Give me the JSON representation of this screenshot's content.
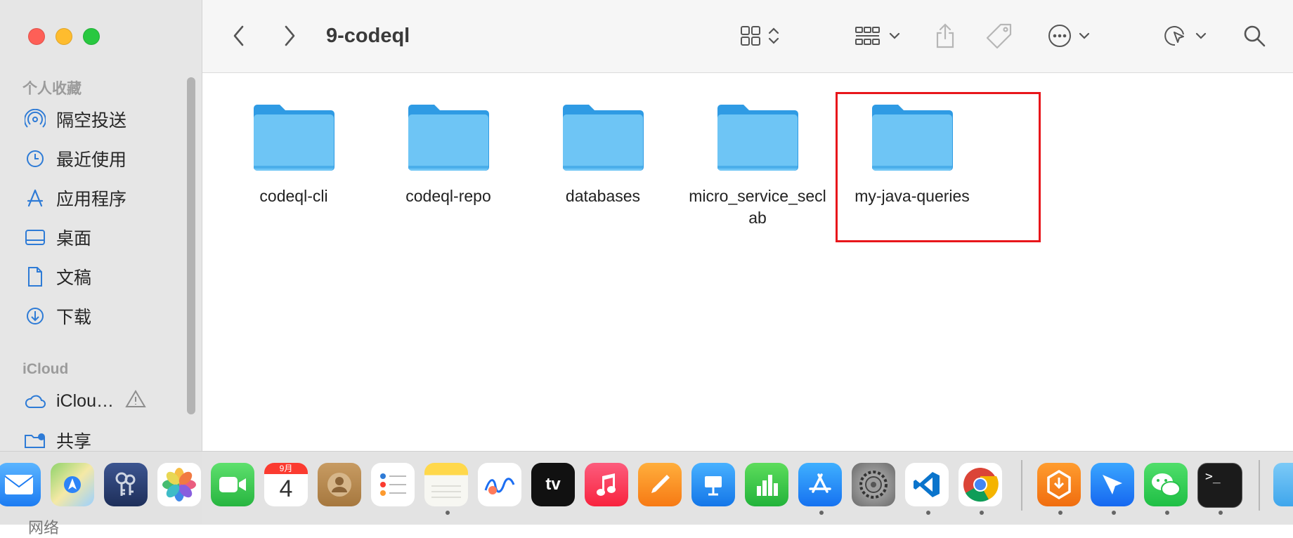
{
  "window": {
    "title": "9-codeql"
  },
  "sidebar": {
    "favorites_title": "个人收藏",
    "items": [
      {
        "label": "隔空投送",
        "icon": "airdrop-icon"
      },
      {
        "label": "最近使用",
        "icon": "clock-icon"
      },
      {
        "label": "应用程序",
        "icon": "applications-icon"
      },
      {
        "label": "桌面",
        "icon": "desktop-icon"
      },
      {
        "label": "文稿",
        "icon": "document-icon"
      },
      {
        "label": "下载",
        "icon": "download-icon"
      }
    ],
    "icloud_title": "iCloud",
    "icloud_items": [
      {
        "label": "iClou…",
        "icon": "icloud-icon"
      },
      {
        "label": "共享",
        "icon": "shared-folder-icon"
      }
    ],
    "network_label": "网络"
  },
  "folders": [
    {
      "name": "codeql-cli"
    },
    {
      "name": "codeql-repo"
    },
    {
      "name": "databases"
    },
    {
      "name": "micro_service_seclab"
    },
    {
      "name": "my-java-queries"
    }
  ],
  "dock": {
    "calendar_month": "9月",
    "calendar_day": "4",
    "apps": [
      "Mail",
      "Maps",
      "Keychain Access",
      "Photos",
      "FaceTime",
      "Calendar",
      "Contacts",
      "Reminders",
      "Notes",
      "Freeform",
      "Apple TV",
      "Music",
      "Pages",
      "Keynote",
      "Numbers",
      "App Store",
      "System Settings",
      "Visual Studio Code",
      "Google Chrome",
      "Burp Suite",
      "Feishu",
      "WeChat",
      "Terminal",
      "Finder Folder"
    ]
  },
  "colors": {
    "highlight": "#e8161b",
    "folder": "#6ec5f5",
    "accent": "#2e7bd6"
  }
}
